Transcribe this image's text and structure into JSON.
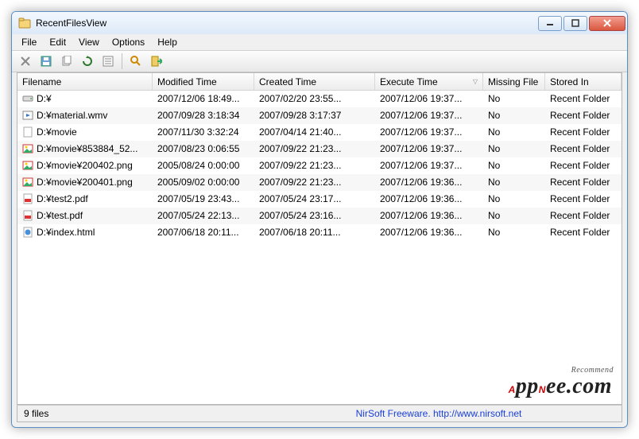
{
  "title": "RecentFilesView",
  "menus": [
    "File",
    "Edit",
    "View",
    "Options",
    "Help"
  ],
  "columns": {
    "filename": "Filename",
    "modified": "Modified Time",
    "created": "Created Time",
    "execute": "Execute Time",
    "missing": "Missing File",
    "stored": "Stored In"
  },
  "sort_column": "execute",
  "sort_dir": "desc",
  "rows": [
    {
      "icon": "drive",
      "filename": "D:¥",
      "modified": "2007/12/06 18:49...",
      "created": "2007/02/20 23:55...",
      "execute": "2007/12/06 19:37...",
      "missing": "No",
      "stored": "Recent Folder"
    },
    {
      "icon": "video",
      "filename": "D:¥material.wmv",
      "modified": "2007/09/28 3:18:34",
      "created": "2007/09/28 3:17:37",
      "execute": "2007/12/06 19:37...",
      "missing": "No",
      "stored": "Recent Folder"
    },
    {
      "icon": "blank",
      "filename": "D:¥movie",
      "modified": "2007/11/30 3:32:24",
      "created": "2007/04/14 21:40...",
      "execute": "2007/12/06 19:37...",
      "missing": "No",
      "stored": "Recent Folder"
    },
    {
      "icon": "image",
      "filename": "D:¥movie¥853884_52...",
      "modified": "2007/08/23 0:06:55",
      "created": "2007/09/22 21:23...",
      "execute": "2007/12/06 19:37...",
      "missing": "No",
      "stored": "Recent Folder"
    },
    {
      "icon": "image",
      "filename": "D:¥movie¥200402.png",
      "modified": "2005/08/24 0:00:00",
      "created": "2007/09/22 21:23...",
      "execute": "2007/12/06 19:37...",
      "missing": "No",
      "stored": "Recent Folder"
    },
    {
      "icon": "image",
      "filename": "D:¥movie¥200401.png",
      "modified": "2005/09/02 0:00:00",
      "created": "2007/09/22 21:23...",
      "execute": "2007/12/06 19:36...",
      "missing": "No",
      "stored": "Recent Folder"
    },
    {
      "icon": "pdf",
      "filename": "D:¥test2.pdf",
      "modified": "2007/05/19 23:43...",
      "created": "2007/05/24 23:17...",
      "execute": "2007/12/06 19:36...",
      "missing": "No",
      "stored": "Recent Folder"
    },
    {
      "icon": "pdf",
      "filename": "D:¥test.pdf",
      "modified": "2007/05/24 22:13...",
      "created": "2007/05/24 23:16...",
      "execute": "2007/12/06 19:36...",
      "missing": "No",
      "stored": "Recent Folder"
    },
    {
      "icon": "html",
      "filename": "D:¥index.html",
      "modified": "2007/06/18 20:11...",
      "created": "2007/06/18 20:11...",
      "execute": "2007/12/06 19:36...",
      "missing": "No",
      "stored": "Recent Folder"
    }
  ],
  "status_left": "9 files",
  "status_center": "NirSoft Freeware.  http://www.nirsoft.net",
  "watermark": {
    "text": "AppNee.com",
    "tag": "Recommend"
  }
}
